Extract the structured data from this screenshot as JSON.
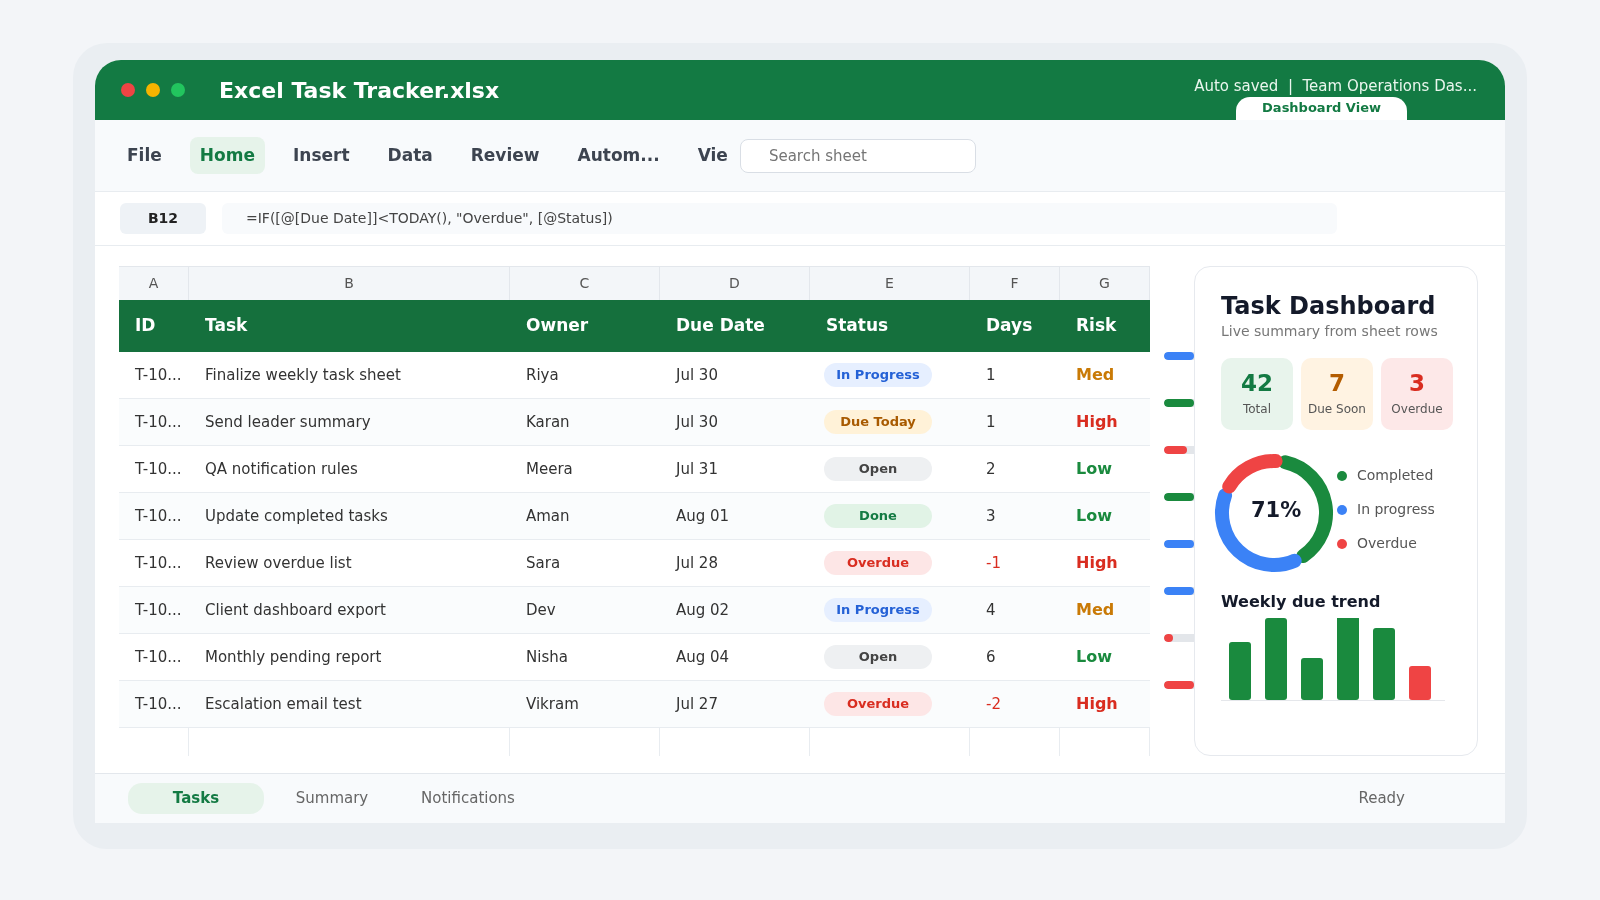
{
  "window": {
    "title": "Excel Task Tracker.xlsx",
    "status_text": "Auto saved  |  Team Operations Das...",
    "view_button": "Dashboard View"
  },
  "ribbon": {
    "tabs": [
      {
        "label": "File",
        "selected": false
      },
      {
        "label": "Home",
        "selected": true
      },
      {
        "label": "Insert",
        "selected": false
      },
      {
        "label": "Data",
        "selected": false
      },
      {
        "label": "Review",
        "selected": false
      },
      {
        "label": "Autom...",
        "selected": false
      },
      {
        "label": "Vie",
        "selected": false
      }
    ],
    "search": {
      "placeholder": "Search sheet"
    }
  },
  "formula_bar": {
    "cell": "B12",
    "formula": "=IF([@[Due Date]]<TODAY(), \"Overdue\", [@Status])"
  },
  "sheet": {
    "column_letters": [
      "A",
      "B",
      "C",
      "D",
      "E",
      "F",
      "G"
    ],
    "columns": [
      "ID",
      "Task",
      "Owner",
      "Due Date",
      "Status",
      "Days",
      "Risk"
    ],
    "rows": [
      {
        "id": "T-10...",
        "task": "Finalize weekly task sheet",
        "owner": "Riya",
        "due": "Jul 30",
        "status": {
          "text": "In Progress",
          "kind": "in_progress"
        },
        "days": "1",
        "days_alert": false,
        "risk": {
          "text": "Med",
          "color": "#c97a06"
        },
        "progress": {
          "level": 1,
          "color": "#3b82f6"
        }
      },
      {
        "id": "T-10...",
        "task": "Send leader summary",
        "owner": "Karan",
        "due": "Jul 30",
        "status": {
          "text": "Due Today",
          "kind": "due_today"
        },
        "days": "1",
        "days_alert": false,
        "risk": {
          "text": "High",
          "color": "#d92d20"
        },
        "progress": {
          "level": 1,
          "color": "#1a8a3e"
        }
      },
      {
        "id": "T-10...",
        "task": "QA notification rules",
        "owner": "Meera",
        "due": "Jul 31",
        "status": {
          "text": "Open",
          "kind": "open"
        },
        "days": "2",
        "days_alert": false,
        "risk": {
          "text": "Low",
          "color": "#1a8a3e"
        },
        "progress": {
          "level": 0.75,
          "color": "#ef4444"
        }
      },
      {
        "id": "T-10...",
        "task": "Update completed tasks",
        "owner": "Aman",
        "due": "Aug 01",
        "status": {
          "text": "Done",
          "kind": "done"
        },
        "days": "3",
        "days_alert": false,
        "risk": {
          "text": "Low",
          "color": "#1a8a3e"
        },
        "progress": {
          "level": 1,
          "color": "#1a8a3e"
        }
      },
      {
        "id": "T-10...",
        "task": "Review overdue list",
        "owner": "Sara",
        "due": "Jul 28",
        "status": {
          "text": "Overdue",
          "kind": "overdue"
        },
        "days": "-1",
        "days_alert": true,
        "risk": {
          "text": "High",
          "color": "#d92d20"
        },
        "progress": {
          "level": 1,
          "color": "#3b82f6"
        }
      },
      {
        "id": "T-10...",
        "task": "Client dashboard export",
        "owner": "Dev",
        "due": "Aug 02",
        "status": {
          "text": "In Progress",
          "kind": "in_progress"
        },
        "days": "4",
        "days_alert": false,
        "risk": {
          "text": "Med",
          "color": "#c97a06"
        },
        "progress": {
          "level": 1,
          "color": "#3b82f6"
        }
      },
      {
        "id": "T-10...",
        "task": "Monthly pending report",
        "owner": "Nisha",
        "due": "Aug 04",
        "status": {
          "text": "Open",
          "kind": "open"
        },
        "days": "6",
        "days_alert": false,
        "risk": {
          "text": "Low",
          "color": "#1a8a3e"
        },
        "progress": {
          "level": 0.3,
          "color": "#ef4444"
        }
      },
      {
        "id": "T-10...",
        "task": "Escalation email test",
        "owner": "Vikram",
        "due": "Jul 27",
        "status": {
          "text": "Overdue",
          "kind": "overdue"
        },
        "days": "-2",
        "days_alert": true,
        "risk": {
          "text": "High",
          "color": "#d92d20"
        },
        "progress": {
          "level": 1,
          "color": "#ef4444"
        }
      }
    ]
  },
  "dashboard": {
    "title": "Task Dashboard",
    "subtitle": "Live summary from sheet rows",
    "stats": [
      {
        "value": "42",
        "label": "Total",
        "kind": "total"
      },
      {
        "value": "7",
        "label": "Due Soon",
        "kind": "due_soon"
      },
      {
        "value": "3",
        "label": "Overdue",
        "kind": "overdue"
      }
    ],
    "donut_center": "71%",
    "legend": [
      {
        "label": "Completed",
        "color": "#1a8a3e"
      },
      {
        "label": "In progress",
        "color": "#3b82f6"
      },
      {
        "label": "Overdue",
        "color": "#ef4444"
      }
    ],
    "trend_title": "Weekly due trend"
  },
  "sheet_tabs": [
    {
      "label": "Tasks",
      "selected": true
    },
    {
      "label": "Summary",
      "selected": false
    },
    {
      "label": "Notifications",
      "selected": false
    }
  ],
  "status_bar": "Ready"
}
